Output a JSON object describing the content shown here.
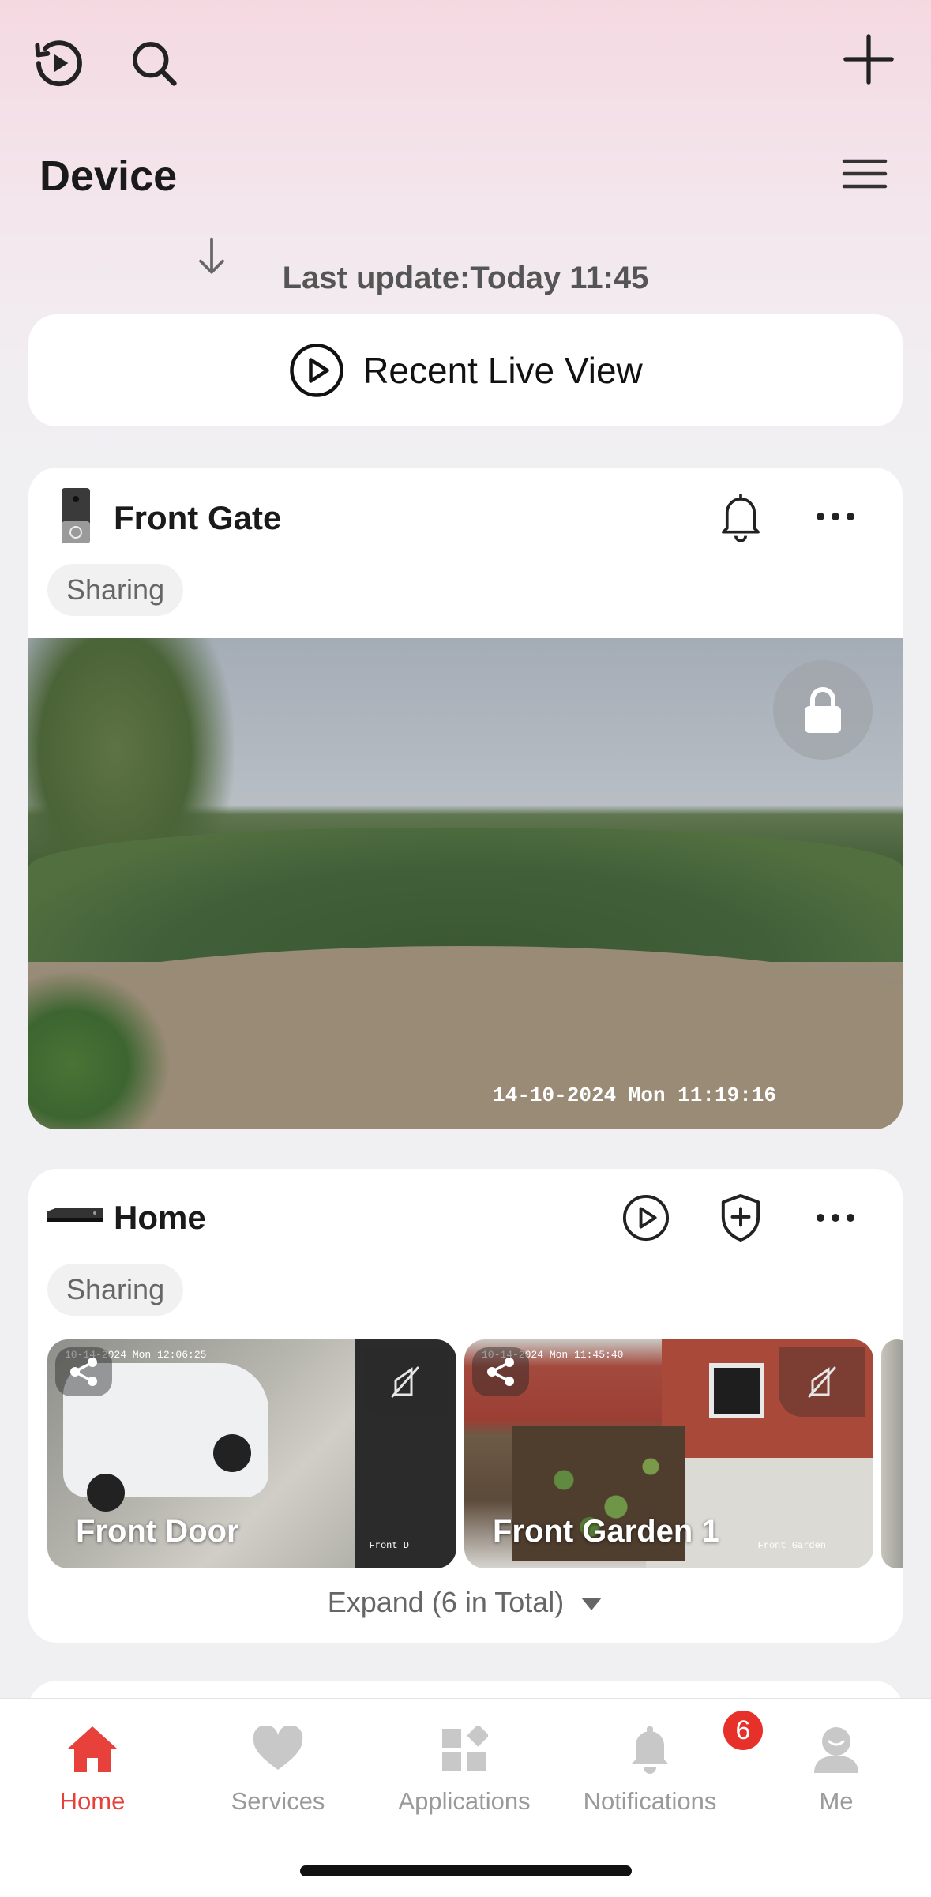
{
  "header": {
    "title": "Device",
    "last_update": "Last update:Today 11:45"
  },
  "recent_live_view": {
    "label": "Recent Live View"
  },
  "devices": [
    {
      "name": "Front Gate",
      "tag": "Sharing",
      "timestamp": "14-10-2024 Mon 11:19:16"
    },
    {
      "name": "Home",
      "tag": "Sharing",
      "cameras": [
        {
          "label": "Front Door",
          "timestamp": "10-14-2024 Mon 12:06:25",
          "overlay_text": "Front D"
        },
        {
          "label": "Front Garden 1",
          "timestamp": "10-14-2024 Mon 11:45:40",
          "overlay_text": "Front Garden"
        }
      ],
      "expand_label": "Expand (6 in Total)"
    }
  ],
  "tab_bar": {
    "items": [
      {
        "label": "Home",
        "icon": "home-icon",
        "active": true
      },
      {
        "label": "Services",
        "icon": "heart-icon",
        "active": false
      },
      {
        "label": "Applications",
        "icon": "apps-icon",
        "active": false
      },
      {
        "label": "Notifications",
        "icon": "bell-icon",
        "active": false,
        "badge": "6"
      },
      {
        "label": "Me",
        "icon": "profile-icon",
        "active": false
      }
    ]
  },
  "colors": {
    "accent": "#e8413c",
    "inactive": "#9a9a9a"
  }
}
